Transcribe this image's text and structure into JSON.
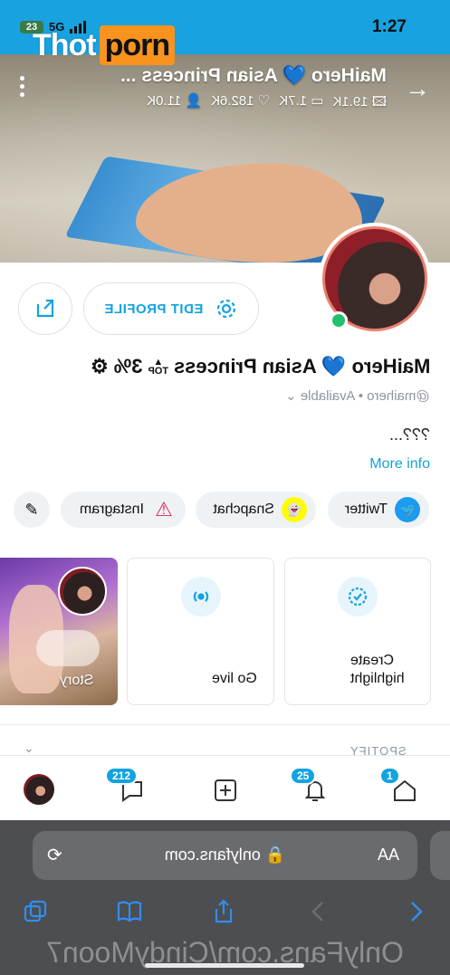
{
  "status_bar": {
    "time": "1:27",
    "network": "5G",
    "battery": "23"
  },
  "watermark": {
    "word": "Thot",
    "box": "porn"
  },
  "cover": {
    "title": "MaiHero 💙 Asian Princess ...",
    "stats": [
      {
        "icon": "image-icon",
        "value": "19.1K"
      },
      {
        "icon": "video-icon",
        "value": "1.7K"
      },
      {
        "icon": "heart-icon",
        "value": "182.6K"
      },
      {
        "icon": "user-icon",
        "value": "11.0K"
      }
    ]
  },
  "profile": {
    "edit_label": "EDIT PROFILE",
    "name": "MaiHero 💙 Asian Princess",
    "top_label": "TOP",
    "top_percent": "3%",
    "handle": "@maihero",
    "availability": "Available",
    "bio": "???...",
    "more_info": "More info"
  },
  "social_links": [
    {
      "label": "Twitter",
      "icon": "twitter-icon",
      "color": "#1d9bf0"
    },
    {
      "label": "Snapchat",
      "icon": "snapchat-icon",
      "color": "#fffc00"
    },
    {
      "label": "Instagram",
      "icon": "warning-icon",
      "color": "#e0245e"
    }
  ],
  "highlights": [
    {
      "label": "Create highlight",
      "icon": "highlight-icon"
    },
    {
      "label": "Go live",
      "icon": "broadcast-icon"
    },
    {
      "label": "Story",
      "icon": "story-avatar"
    }
  ],
  "section": {
    "spotify": "SPOTIFY"
  },
  "tabbar": {
    "home_badge": "1",
    "notifications_badge": "25",
    "messages_badge": "212"
  },
  "browser": {
    "aa": "AA",
    "url": "onlyfans.com",
    "bottom_url": "OnlyFans.com/CindyMoon7"
  },
  "colors": {
    "accent": "#12a3e0",
    "status_bar": "#18a2e0",
    "online": "#25c06d"
  }
}
